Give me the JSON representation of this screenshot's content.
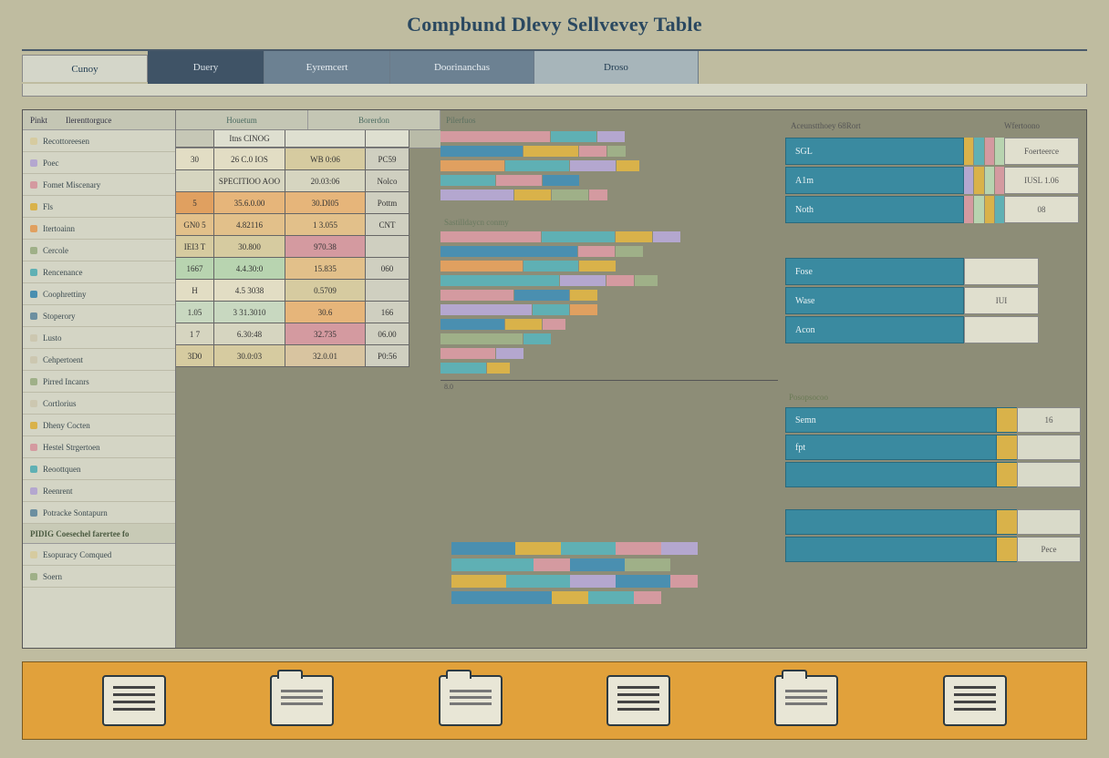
{
  "title": "Compbund Dlevy Sellvevey Table",
  "tabs": [
    "Cunoy",
    "Duery",
    "Eyremcert",
    "Doorinanchas",
    "Droso"
  ],
  "sidebar": {
    "head": [
      "Pinkt",
      "Ilerenttorguce"
    ],
    "items": [
      {
        "label": "Recottoreesen",
        "color": "#d6cba0"
      },
      {
        "label": "Poec",
        "color": "#b4a7cf"
      },
      {
        "label": "Fomet Miscenary",
        "color": "#d49aa0"
      },
      {
        "label": "Fls",
        "color": "#d9b24a"
      },
      {
        "label": "Itertoainn",
        "color": "#e0a060"
      },
      {
        "label": "Cercole",
        "color": "#9fb088"
      },
      {
        "label": "Rencenance",
        "color": "#5fb0b4"
      },
      {
        "label": "Coophrettiny",
        "color": "#4a8fb0"
      },
      {
        "label": "Stoperory",
        "color": "#6c8fa0"
      },
      {
        "label": "Lusto",
        "color": ""
      },
      {
        "label": "Cehpertoent",
        "color": ""
      },
      {
        "label": "Pirred Incanrs",
        "color": "#9fb088"
      },
      {
        "label": "Cortlorius",
        "color": ""
      },
      {
        "label": "Dheny Cocten",
        "color": "#d9b24a"
      },
      {
        "label": "Hestel Strgertoen",
        "color": "#d49aa0"
      },
      {
        "label": "Reoottquen",
        "color": "#5fb0b4"
      },
      {
        "label": "Reenrent",
        "color": "#b4a7cf"
      },
      {
        "label": "Potracke Sontapurn",
        "color": "#6c8fa0"
      }
    ],
    "section2": "PIDIG Coesechel farertee fo",
    "items2": [
      {
        "label": "Esopuracy Comqued",
        "color": "#d6cba0"
      },
      {
        "label": "Soern",
        "color": "#9fb088"
      }
    ]
  },
  "grid": {
    "headers": [
      "Houetum",
      "Borerdon"
    ],
    "sub1": {
      "cells": [
        "",
        "Itns CINOG",
        "",
        "",
        ""
      ]
    },
    "rows": [
      {
        "a": "30",
        "b": "26 C.0 IOS",
        "c": "WB 0:06",
        "d": "PC59",
        "bg": [
          "#e2ddc4",
          "#e2ddc4",
          "#d6cba0",
          "#cfcfc0"
        ]
      },
      {
        "a": "",
        "b": "SPECITIOO AOO",
        "c": "20.03:06",
        "d": "Nolco",
        "bg": [
          "#d6d5c0",
          "#d6d5c0",
          "#d6d5c0",
          "#cfcfc0"
        ]
      },
      {
        "a": "5",
        "b": "35.6.0.00",
        "c": "30.DI05",
        "d": "Pottm",
        "bg": [
          "#e0a060",
          "#e6b57a",
          "#e6b57a",
          "#cfcfc0"
        ]
      },
      {
        "a": "GN0 5",
        "b": "4.82116",
        "c": "1 3.055",
        "d": "CNT",
        "bg": [
          "#e2c08a",
          "#e2c08a",
          "#e2c08a",
          "#cfcfc0"
        ]
      },
      {
        "a": "IEI3 T",
        "b": "30.800",
        "c": "970.38",
        "d": "",
        "bg": [
          "#d6cba0",
          "#d6cba0",
          "#d49aa0",
          "#cfcfc0"
        ]
      },
      {
        "a": "1667",
        "b": "4.4.30:0",
        "c": "15.835",
        "d": "060",
        "bg": [
          "#b8d4b0",
          "#b8d4b0",
          "#e2c08a",
          "#cfcfc0"
        ]
      },
      {
        "a": "H",
        "b": "4.5 3038",
        "c": "0.5709",
        "d": "",
        "bg": [
          "#e2ddc4",
          "#e2ddc4",
          "#d6cba0",
          "#cfcfc0"
        ]
      },
      {
        "a": "1.05",
        "b": "3 31.3010",
        "c": "30.6",
        "d": "166",
        "bg": [
          "#c8d8c0",
          "#c8d8c0",
          "#e6b57a",
          "#cfcfc0"
        ]
      },
      {
        "a": "1 7",
        "b": "6.30:48",
        "c": "32.735",
        "d": "06.00",
        "bg": [
          "#d6d5c0",
          "#d6d5c0",
          "#d49aa0",
          "#cfcfc0"
        ]
      },
      {
        "a": "3D0",
        "b": "30.0:03",
        "c": "32.0.01",
        "d": "P0:56",
        "bg": [
          "#d6cba0",
          "#d6cba0",
          "#d8c4a0",
          "#cfcfc0"
        ]
      }
    ]
  },
  "center": {
    "title": "Pilerfuos",
    "title2": "Sastilldaycn conmy"
  },
  "right_top": {
    "headA": "Aceunstthoey 68Rort",
    "headB": "Wfertoono",
    "rows": [
      {
        "label": "SGL",
        "mid": [
          "#d9b24a",
          "#5fb0b4",
          "#d49aa0",
          "#b8d4b0"
        ],
        "val": "Foerteerce"
      },
      {
        "label": "A1m",
        "mid": [
          "#b4a7cf",
          "#d9b24a",
          "#b8d4b0",
          "#d49aa0"
        ],
        "val": "IUSL 1.06"
      },
      {
        "label": "Noth",
        "mid": [
          "#d49aa0",
          "#b8d4b0",
          "#d9b24a",
          "#5fb0b4"
        ],
        "val": "08"
      }
    ],
    "rows2": [
      {
        "label": "Fose",
        "mid": [],
        "val": ""
      },
      {
        "label": "Wase",
        "mid": [],
        "val": "IUI"
      },
      {
        "label": "Acon",
        "mid": [],
        "val": ""
      }
    ]
  },
  "right_mid": {
    "title": "Posopsocoo",
    "rows": [
      {
        "label": "Semn",
        "val": "16"
      },
      {
        "label": "fpt",
        "val": ""
      },
      {
        "label": "",
        "val": ""
      }
    ]
  },
  "right_bot": {
    "rows": [
      {
        "label": "",
        "val": ""
      },
      {
        "label": "",
        "val": "Pece"
      }
    ]
  },
  "footer_icons": [
    "doc",
    "folder",
    "folder",
    "doc",
    "folder",
    "doc"
  ],
  "chart_data": {
    "type": "bar",
    "title": "Pilerfuos",
    "orientation": "horizontal",
    "stacked": true,
    "xlim": [
      0,
      260
    ],
    "series_colors": {
      "a": "#4a8fb0",
      "b": "#5fb0b4",
      "c": "#d9b24a",
      "d": "#d49aa0",
      "e": "#b4a7cf",
      "f": "#e0a060",
      "g": "#9fb088"
    },
    "group1": [
      [
        {
          "c": "#d49aa0",
          "w": 120
        },
        {
          "c": "#5fb0b4",
          "w": 50
        },
        {
          "c": "#b4a7cf",
          "w": 30
        }
      ],
      [
        {
          "c": "#4a8fb0",
          "w": 90
        },
        {
          "c": "#d9b24a",
          "w": 60
        },
        {
          "c": "#d49aa0",
          "w": 30
        },
        {
          "c": "#9fb088",
          "w": 20
        }
      ],
      [
        {
          "c": "#e0a060",
          "w": 70
        },
        {
          "c": "#5fb0b4",
          "w": 70
        },
        {
          "c": "#b4a7cf",
          "w": 50
        },
        {
          "c": "#d9b24a",
          "w": 25
        }
      ],
      [
        {
          "c": "#5fb0b4",
          "w": 60
        },
        {
          "c": "#d49aa0",
          "w": 50
        },
        {
          "c": "#4a8fb0",
          "w": 40
        }
      ],
      [
        {
          "c": "#b4a7cf",
          "w": 80
        },
        {
          "c": "#d9b24a",
          "w": 40
        },
        {
          "c": "#9fb088",
          "w": 40
        },
        {
          "c": "#d49aa0",
          "w": 20
        }
      ]
    ],
    "group2_title": "Sastilldaycn conmy",
    "group2": [
      [
        {
          "c": "#d49aa0",
          "w": 110
        },
        {
          "c": "#5fb0b4",
          "w": 80
        },
        {
          "c": "#d9b24a",
          "w": 40
        },
        {
          "c": "#b4a7cf",
          "w": 30
        }
      ],
      [
        {
          "c": "#4a8fb0",
          "w": 150
        },
        {
          "c": "#d49aa0",
          "w": 40
        },
        {
          "c": "#9fb088",
          "w": 30
        }
      ],
      [
        {
          "c": "#e0a060",
          "w": 90
        },
        {
          "c": "#5fb0b4",
          "w": 60
        },
        {
          "c": "#d9b24a",
          "w": 40
        }
      ],
      [
        {
          "c": "#5fb0b4",
          "w": 130
        },
        {
          "c": "#b4a7cf",
          "w": 50
        },
        {
          "c": "#d49aa0",
          "w": 30
        },
        {
          "c": "#9fb088",
          "w": 25
        }
      ],
      [
        {
          "c": "#d49aa0",
          "w": 80
        },
        {
          "c": "#4a8fb0",
          "w": 60
        },
        {
          "c": "#d9b24a",
          "w": 30
        }
      ],
      [
        {
          "c": "#b4a7cf",
          "w": 100
        },
        {
          "c": "#5fb0b4",
          "w": 40
        },
        {
          "c": "#e0a060",
          "w": 30
        }
      ],
      [
        {
          "c": "#4a8fb0",
          "w": 70
        },
        {
          "c": "#d9b24a",
          "w": 40
        },
        {
          "c": "#d49aa0",
          "w": 25
        }
      ],
      [
        {
          "c": "#9fb088",
          "w": 90
        },
        {
          "c": "#5fb0b4",
          "w": 30
        }
      ],
      [
        {
          "c": "#d49aa0",
          "w": 60
        },
        {
          "c": "#b4a7cf",
          "w": 30
        }
      ],
      [
        {
          "c": "#5fb0b4",
          "w": 50
        },
        {
          "c": "#d9b24a",
          "w": 25
        }
      ]
    ],
    "bottom_stack": [
      [
        {
          "c": "#4a8fb0",
          "w": 70
        },
        {
          "c": "#d9b24a",
          "w": 50
        },
        {
          "c": "#5fb0b4",
          "w": 60
        },
        {
          "c": "#d49aa0",
          "w": 50
        },
        {
          "c": "#b4a7cf",
          "w": 40
        }
      ],
      [
        {
          "c": "#5fb0b4",
          "w": 90
        },
        {
          "c": "#d49aa0",
          "w": 40
        },
        {
          "c": "#4a8fb0",
          "w": 60
        },
        {
          "c": "#9fb088",
          "w": 50
        }
      ],
      [
        {
          "c": "#d9b24a",
          "w": 60
        },
        {
          "c": "#5fb0b4",
          "w": 70
        },
        {
          "c": "#b4a7cf",
          "w": 50
        },
        {
          "c": "#4a8fb0",
          "w": 60
        },
        {
          "c": "#d49aa0",
          "w": 30
        }
      ],
      [
        {
          "c": "#4a8fb0",
          "w": 110
        },
        {
          "c": "#d9b24a",
          "w": 40
        },
        {
          "c": "#5fb0b4",
          "w": 50
        },
        {
          "c": "#d49aa0",
          "w": 30
        }
      ]
    ],
    "ticks": [
      "8.0",
      "",
      "",
      "",
      "",
      ""
    ]
  }
}
